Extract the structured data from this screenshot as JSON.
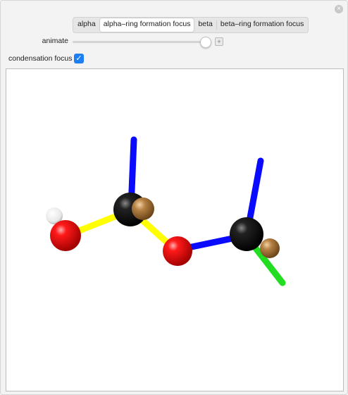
{
  "window": {
    "close_symbol": "×"
  },
  "tabs": [
    {
      "label": "alpha",
      "active": false
    },
    {
      "label": "alpha–ring formation focus",
      "active": true
    },
    {
      "label": "beta",
      "active": false
    },
    {
      "label": "beta–ring formation focus",
      "active": false
    }
  ],
  "animate": {
    "label": "animate",
    "value_fraction": 0.96,
    "plus_symbol": "+"
  },
  "condensation": {
    "label": "condensation focus",
    "checked": true,
    "check_symbol": "✓"
  },
  "molecule": {
    "colors": {
      "carbon": "#000000",
      "oxygen": "#e00000",
      "hydrogen": "#ffffff",
      "substituent": "#b07a3a",
      "bond_blue": "#0a0aff",
      "bond_yellow": "#ffff00",
      "bond_green": "#22dd22"
    }
  }
}
